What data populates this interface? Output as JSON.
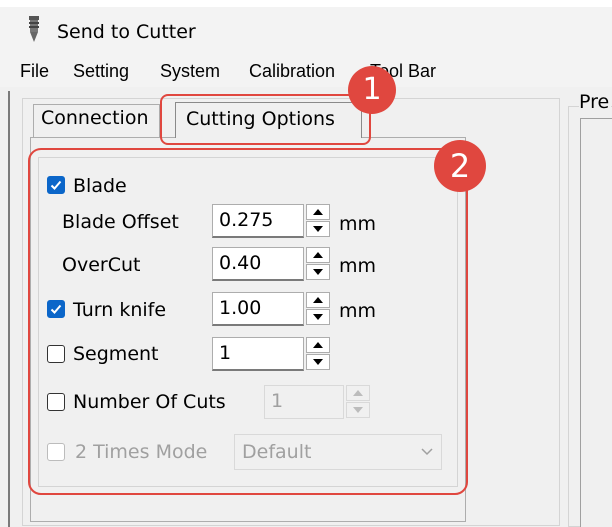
{
  "window": {
    "title": "Send to Cutter",
    "app_icon": "cutter-pen-icon"
  },
  "menu": [
    "File",
    "Setting",
    "System",
    "Calibration",
    "Tool Bar"
  ],
  "tabs": {
    "connection": "Connection",
    "cutting_options": "Cutting Options",
    "active": "Cutting Options"
  },
  "preview": {
    "label": "Pre"
  },
  "form": {
    "blade": {
      "label": "Blade",
      "checked": true
    },
    "blade_offset": {
      "label": "Blade Offset",
      "value": "0.275",
      "unit": "mm"
    },
    "overcut": {
      "label": "OverCut",
      "value": "0.40",
      "unit": "mm"
    },
    "turn_knife": {
      "label": "Turn knife",
      "checked": true,
      "value": "1.00",
      "unit": "mm"
    },
    "segment": {
      "label": "Segment",
      "checked": false,
      "value": "1"
    },
    "number_of_cuts": {
      "label": "Number Of Cuts",
      "checked": false,
      "value": "1",
      "disabled_input": true
    },
    "two_times_mode": {
      "label": "2 Times Mode",
      "checked": false,
      "disabled": true,
      "selected": "Default"
    }
  },
  "annotations": {
    "badge1": "1",
    "badge2": "2",
    "color": "#e0473f"
  },
  "colors": {
    "checkbox_checked": "#0b66c9",
    "window_background": "#f0f0f0",
    "titlebar_background": "#f3f3f3"
  }
}
